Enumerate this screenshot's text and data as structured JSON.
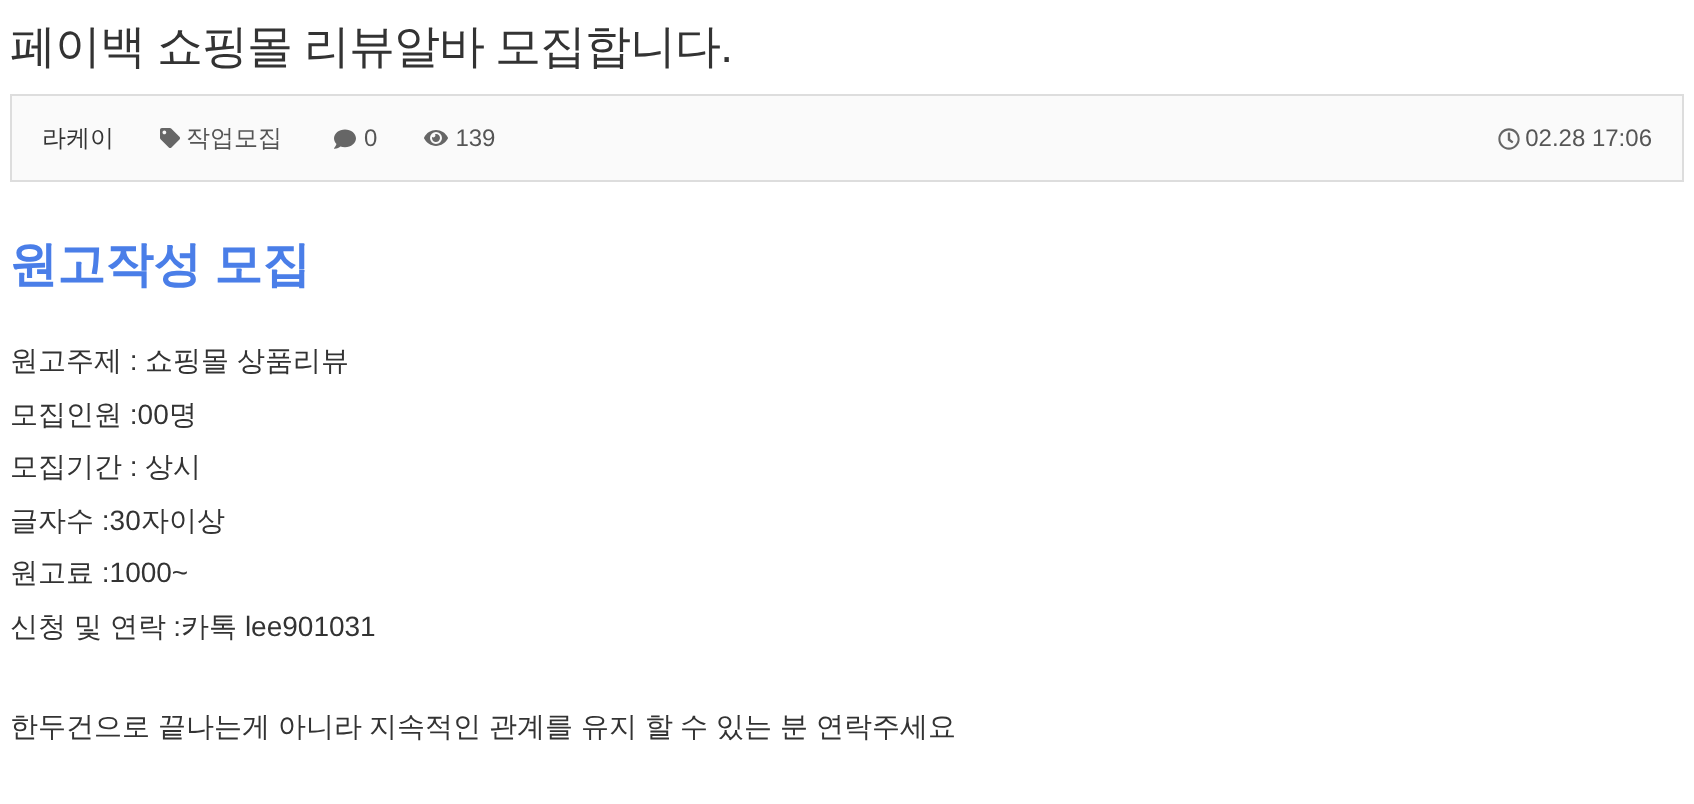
{
  "title": "페이백 쇼핑몰 리뷰알바 모집합니다.",
  "meta": {
    "author": "라케이",
    "category": "작업모집",
    "comments": "0",
    "views": "139",
    "date": "02.28 17:06"
  },
  "heading": "원고작성 모집",
  "lines": [
    "원고주제 : 쇼핑몰 상품리뷰",
    "모집인원 :00명",
    "모집기간 : 상시",
    "글자수 :30자이상",
    "원고료 :1000~",
    "신청 및 연락 :카톡 lee901031"
  ],
  "closing": "한두건으로 끝나는게 아니라 지속적인 관계를 유지 할 수 있는 분 연락주세요"
}
